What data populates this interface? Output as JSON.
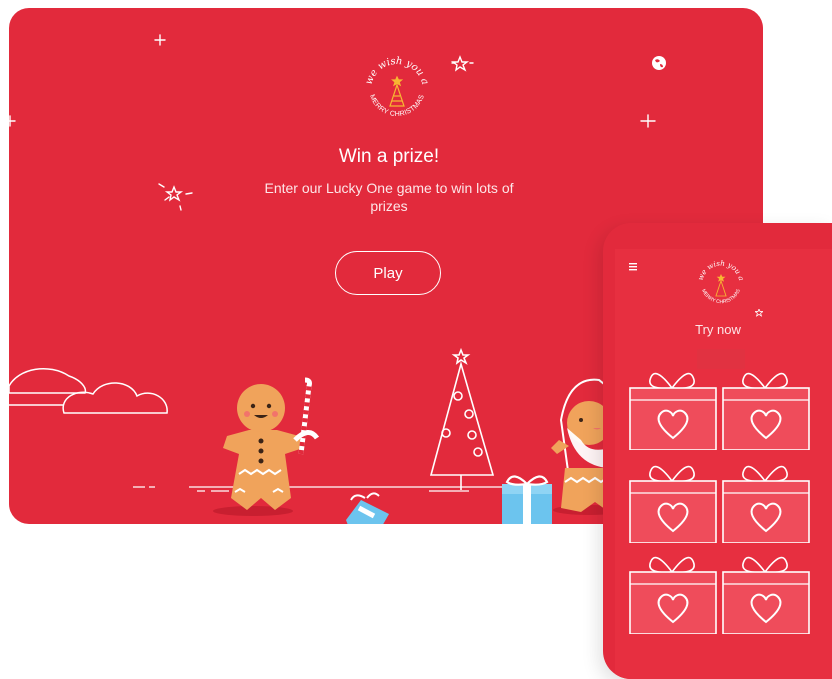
{
  "tablet": {
    "logo": {
      "top_text": "we wish you a",
      "bottom_text": "MERRY CHRISTMAS",
      "icon": "christmas-tree-icon"
    },
    "title": "Win a prize!",
    "subtitle": "Enter our Lucky One game to win lots of prizes",
    "play_button": "Play",
    "globe_icon": "globe-icon"
  },
  "phone": {
    "menu_icon": "hamburger-menu-icon",
    "logo": {
      "top_text": "we wish you a",
      "bottom_text": "MERRY CHRISTMAS"
    },
    "try_now": "Try now",
    "gifts": [
      "gift-1",
      "gift-2",
      "gift-3",
      "gift-4",
      "gift-5",
      "gift-6"
    ]
  },
  "colors": {
    "background_red": "#e22a3c",
    "gift_red": "#ef4c5b",
    "line_white": "#ffffff",
    "gingerbread": "#f0a35b",
    "present_blue": "#6cc4ee"
  }
}
